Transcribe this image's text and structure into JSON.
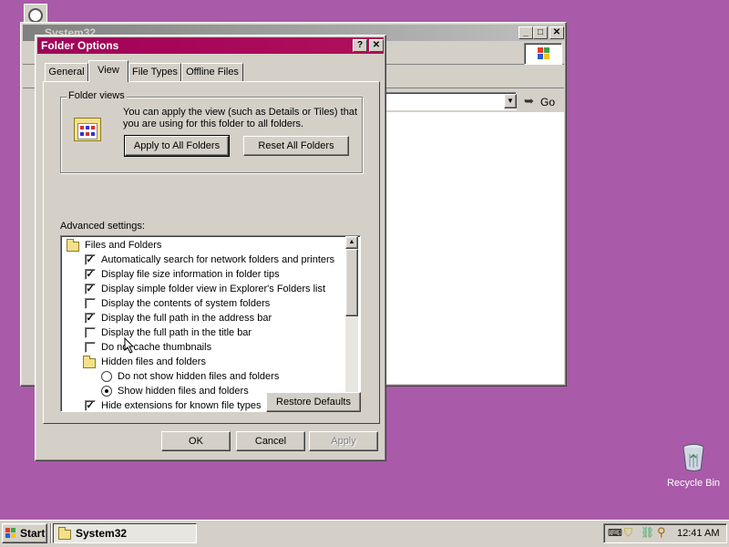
{
  "desktop": {
    "recycle_bin_label": "Recycle Bin"
  },
  "explorer": {
    "title": "System32",
    "go_label": "Go"
  },
  "dialog": {
    "title": "Folder Options",
    "tabs": [
      "General",
      "View",
      "File Types",
      "Offline Files"
    ],
    "active_tab": "View",
    "folder_views": {
      "legend": "Folder views",
      "description": "You can apply the view (such as Details or Tiles) that you are using for this folder to all folders.",
      "apply_all_label": "Apply to All Folders",
      "reset_all_label": "Reset All Folders"
    },
    "advanced_label": "Advanced settings:",
    "tree": {
      "group_files_folders": "Files and Folders",
      "items": [
        {
          "label": "Automatically search for network folders and printers",
          "checked": true
        },
        {
          "label": "Display file size information in folder tips",
          "checked": true
        },
        {
          "label": "Display simple folder view in Explorer's Folders list",
          "checked": true
        },
        {
          "label": "Display the contents of system folders",
          "checked": false
        },
        {
          "label": "Display the full path in the address bar",
          "checked": true
        },
        {
          "label": "Display the full path in the title bar",
          "checked": false
        },
        {
          "label": "Do not cache thumbnails",
          "checked": false
        }
      ],
      "group_hidden": "Hidden files and folders",
      "radios": [
        {
          "label": "Do not show hidden files and folders",
          "selected": false
        },
        {
          "label": "Show hidden files and folders",
          "selected": true
        }
      ],
      "last_item": {
        "label": "Hide extensions for known file types",
        "checked": true
      }
    },
    "restore_label": "Restore Defaults",
    "ok_label": "OK",
    "cancel_label": "Cancel",
    "apply_label": "Apply"
  },
  "taskbar": {
    "start_label": "Start",
    "task_label": "System32",
    "clock": "12:41 AM"
  }
}
